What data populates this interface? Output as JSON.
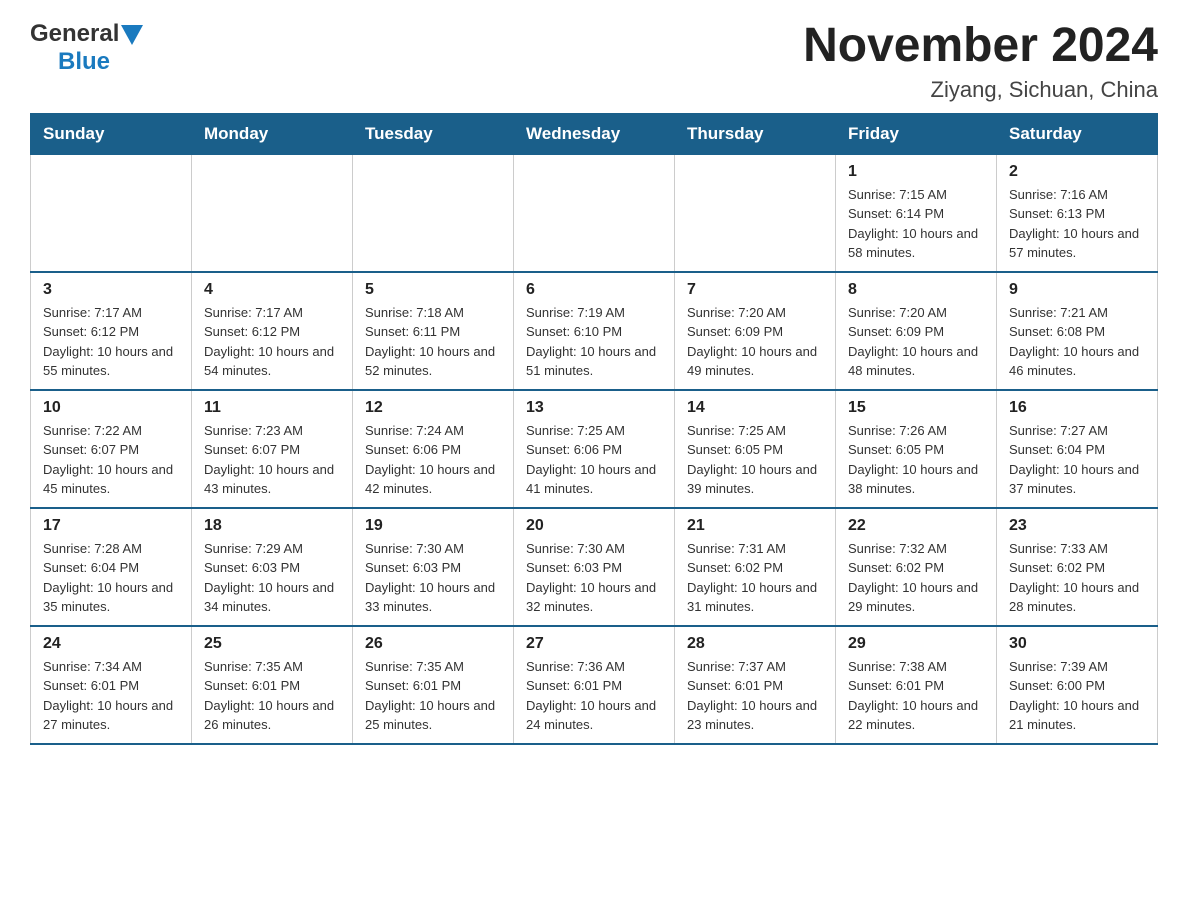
{
  "header": {
    "title": "November 2024",
    "subtitle": "Ziyang, Sichuan, China",
    "logo_general": "General",
    "logo_blue": "Blue"
  },
  "weekdays": [
    "Sunday",
    "Monday",
    "Tuesday",
    "Wednesday",
    "Thursday",
    "Friday",
    "Saturday"
  ],
  "weeks": [
    [
      {
        "day": "",
        "info": ""
      },
      {
        "day": "",
        "info": ""
      },
      {
        "day": "",
        "info": ""
      },
      {
        "day": "",
        "info": ""
      },
      {
        "day": "",
        "info": ""
      },
      {
        "day": "1",
        "info": "Sunrise: 7:15 AM\nSunset: 6:14 PM\nDaylight: 10 hours and 58 minutes."
      },
      {
        "day": "2",
        "info": "Sunrise: 7:16 AM\nSunset: 6:13 PM\nDaylight: 10 hours and 57 minutes."
      }
    ],
    [
      {
        "day": "3",
        "info": "Sunrise: 7:17 AM\nSunset: 6:12 PM\nDaylight: 10 hours and 55 minutes."
      },
      {
        "day": "4",
        "info": "Sunrise: 7:17 AM\nSunset: 6:12 PM\nDaylight: 10 hours and 54 minutes."
      },
      {
        "day": "5",
        "info": "Sunrise: 7:18 AM\nSunset: 6:11 PM\nDaylight: 10 hours and 52 minutes."
      },
      {
        "day": "6",
        "info": "Sunrise: 7:19 AM\nSunset: 6:10 PM\nDaylight: 10 hours and 51 minutes."
      },
      {
        "day": "7",
        "info": "Sunrise: 7:20 AM\nSunset: 6:09 PM\nDaylight: 10 hours and 49 minutes."
      },
      {
        "day": "8",
        "info": "Sunrise: 7:20 AM\nSunset: 6:09 PM\nDaylight: 10 hours and 48 minutes."
      },
      {
        "day": "9",
        "info": "Sunrise: 7:21 AM\nSunset: 6:08 PM\nDaylight: 10 hours and 46 minutes."
      }
    ],
    [
      {
        "day": "10",
        "info": "Sunrise: 7:22 AM\nSunset: 6:07 PM\nDaylight: 10 hours and 45 minutes."
      },
      {
        "day": "11",
        "info": "Sunrise: 7:23 AM\nSunset: 6:07 PM\nDaylight: 10 hours and 43 minutes."
      },
      {
        "day": "12",
        "info": "Sunrise: 7:24 AM\nSunset: 6:06 PM\nDaylight: 10 hours and 42 minutes."
      },
      {
        "day": "13",
        "info": "Sunrise: 7:25 AM\nSunset: 6:06 PM\nDaylight: 10 hours and 41 minutes."
      },
      {
        "day": "14",
        "info": "Sunrise: 7:25 AM\nSunset: 6:05 PM\nDaylight: 10 hours and 39 minutes."
      },
      {
        "day": "15",
        "info": "Sunrise: 7:26 AM\nSunset: 6:05 PM\nDaylight: 10 hours and 38 minutes."
      },
      {
        "day": "16",
        "info": "Sunrise: 7:27 AM\nSunset: 6:04 PM\nDaylight: 10 hours and 37 minutes."
      }
    ],
    [
      {
        "day": "17",
        "info": "Sunrise: 7:28 AM\nSunset: 6:04 PM\nDaylight: 10 hours and 35 minutes."
      },
      {
        "day": "18",
        "info": "Sunrise: 7:29 AM\nSunset: 6:03 PM\nDaylight: 10 hours and 34 minutes."
      },
      {
        "day": "19",
        "info": "Sunrise: 7:30 AM\nSunset: 6:03 PM\nDaylight: 10 hours and 33 minutes."
      },
      {
        "day": "20",
        "info": "Sunrise: 7:30 AM\nSunset: 6:03 PM\nDaylight: 10 hours and 32 minutes."
      },
      {
        "day": "21",
        "info": "Sunrise: 7:31 AM\nSunset: 6:02 PM\nDaylight: 10 hours and 31 minutes."
      },
      {
        "day": "22",
        "info": "Sunrise: 7:32 AM\nSunset: 6:02 PM\nDaylight: 10 hours and 29 minutes."
      },
      {
        "day": "23",
        "info": "Sunrise: 7:33 AM\nSunset: 6:02 PM\nDaylight: 10 hours and 28 minutes."
      }
    ],
    [
      {
        "day": "24",
        "info": "Sunrise: 7:34 AM\nSunset: 6:01 PM\nDaylight: 10 hours and 27 minutes."
      },
      {
        "day": "25",
        "info": "Sunrise: 7:35 AM\nSunset: 6:01 PM\nDaylight: 10 hours and 26 minutes."
      },
      {
        "day": "26",
        "info": "Sunrise: 7:35 AM\nSunset: 6:01 PM\nDaylight: 10 hours and 25 minutes."
      },
      {
        "day": "27",
        "info": "Sunrise: 7:36 AM\nSunset: 6:01 PM\nDaylight: 10 hours and 24 minutes."
      },
      {
        "day": "28",
        "info": "Sunrise: 7:37 AM\nSunset: 6:01 PM\nDaylight: 10 hours and 23 minutes."
      },
      {
        "day": "29",
        "info": "Sunrise: 7:38 AM\nSunset: 6:01 PM\nDaylight: 10 hours and 22 minutes."
      },
      {
        "day": "30",
        "info": "Sunrise: 7:39 AM\nSunset: 6:00 PM\nDaylight: 10 hours and 21 minutes."
      }
    ]
  ]
}
